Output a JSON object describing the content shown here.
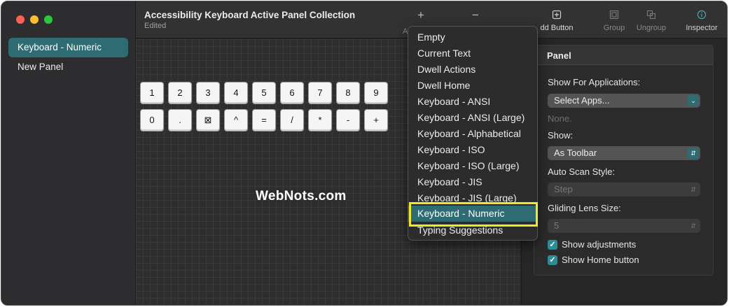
{
  "window": {
    "title": "Accessibility Keyboard Active Panel Collection",
    "subtitle": "Edited"
  },
  "sidebar": {
    "items": [
      {
        "label": "Keyboard - Numeric",
        "selected": true
      },
      {
        "label": "New Panel",
        "selected": false
      }
    ]
  },
  "toolbar": {
    "add_glyph": "+",
    "remove_glyph": "−",
    "add_truncated": "A",
    "add_button_label": "dd Button",
    "group_label": "Group",
    "ungroup_label": "Ungroup",
    "inspector_label": "Inspector"
  },
  "keyboard": {
    "row1": [
      "1",
      "2",
      "3",
      "4",
      "5",
      "6",
      "7",
      "8",
      "9"
    ],
    "row2": [
      "0",
      ".",
      "⊠",
      "^",
      "=",
      "/",
      "*",
      "-",
      "+"
    ]
  },
  "watermark": "WebNots.com",
  "menu": {
    "items": [
      "Empty",
      "Current Text",
      "Dwell Actions",
      "Dwell Home",
      "Keyboard - ANSI",
      "Keyboard - ANSI (Large)",
      "Keyboard - Alphabetical",
      "Keyboard - ISO",
      "Keyboard - ISO (Large)",
      "Keyboard - JIS",
      "Keyboard - JIS (Large)",
      "Keyboard - Numeric",
      "Typing Suggestions"
    ],
    "selected": "Keyboard - Numeric"
  },
  "inspector": {
    "panel_title": "Panel",
    "show_for_apps_label": "Show For Applications:",
    "select_apps_value": "Select Apps...",
    "apps_none": "None.",
    "show_label": "Show:",
    "show_value": "As Toolbar",
    "auto_scan_label": "Auto Scan Style:",
    "auto_scan_value": "Step",
    "gliding_lens_label": "Gliding Lens Size:",
    "gliding_lens_value": "5",
    "show_adjustments_label": "Show adjustments",
    "show_home_label": "Show Home button"
  },
  "colors": {
    "accent": "#2e6b73",
    "highlight": "#f0e92a"
  }
}
